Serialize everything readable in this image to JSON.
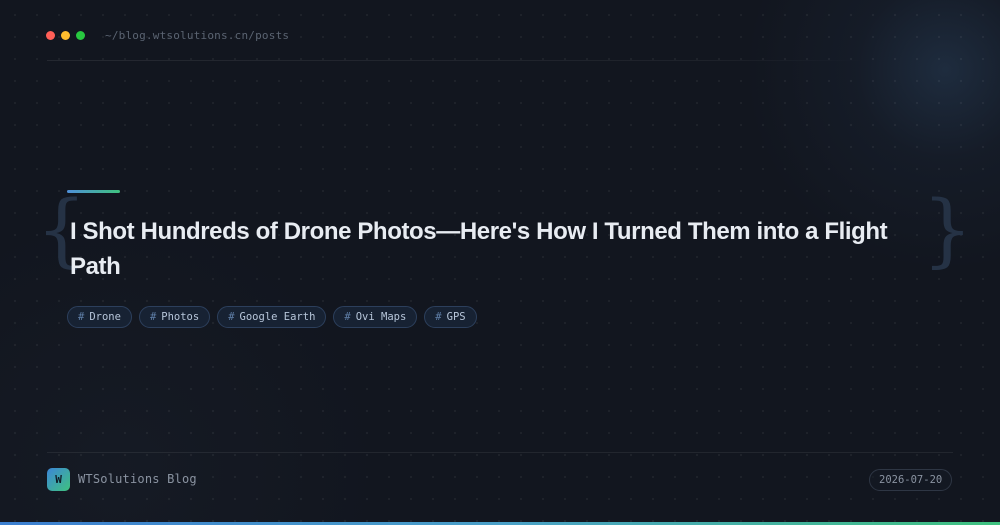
{
  "window": {
    "controls": [
      {
        "name": "close",
        "color": "#ff5f57"
      },
      {
        "name": "minimize",
        "color": "#febc2e"
      },
      {
        "name": "maximize",
        "color": "#28c840"
      }
    ],
    "path": "~/blog.wtsolutions.cn/posts"
  },
  "post": {
    "title": "I Shot Hundreds of Drone Photos—Here's How I Turned Them into a Flight Path",
    "brace_open": "{",
    "brace_close": "}",
    "tag_prefix": "#",
    "tags": [
      {
        "label": "Drone"
      },
      {
        "label": "Photos"
      },
      {
        "label": "Google Earth"
      },
      {
        "label": "Ovi Maps"
      },
      {
        "label": "GPS"
      }
    ]
  },
  "footer": {
    "logo_letter": "W",
    "brand": "WTSolutions Blog",
    "date": "2026-07-20"
  },
  "colors": {
    "background": "#12161f",
    "accent_blue": "#3c86d8",
    "accent_green": "#3fc27f",
    "title": "#e8ecf2"
  }
}
